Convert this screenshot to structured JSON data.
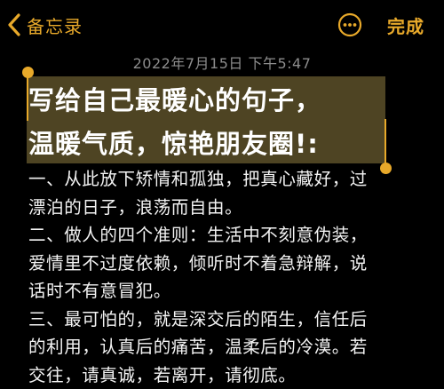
{
  "navbar": {
    "back_label": "备忘录",
    "done_label": "完成",
    "accent_color": "#e8a92a",
    "back_icon": "chevron-left-icon",
    "more_icon": "ellipsis-circle-icon"
  },
  "note": {
    "timestamp": "2022年7月15日 下午5:47",
    "title_lines": [
      "写给自己最暖心的句子，",
      "温暖气质，惊艳朋友圈!:"
    ],
    "body_lines": [
      "一、从此放下矫情和孤独，把真心藏好，过",
      "漂泊的日子，浪荡而自由。",
      "二、做人的四个准则：生活中不刻意伪装，",
      "爱情里不过度依赖，倾听时不着急辩解，说",
      "话时不有意冒犯。",
      "三、最可怕的，就是深交后的陌生，信任后",
      "的利用，认真后的痛苦，温柔后的冷漠。若",
      "交往，请真诚，若离开，请彻底。"
    ]
  }
}
